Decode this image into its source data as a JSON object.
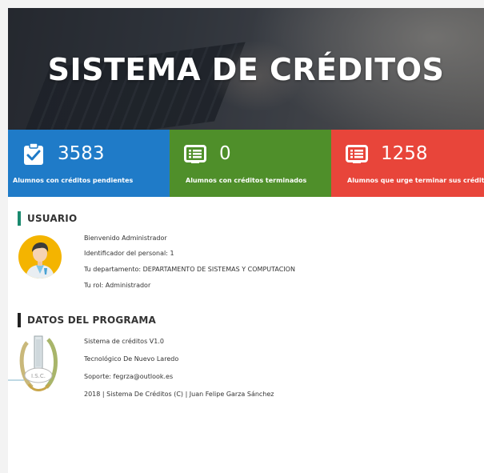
{
  "header": {
    "title": "SISTEMA DE CRÉDITOS"
  },
  "stats": [
    {
      "value": "3583",
      "label": "Alumnos con créditos pendientes",
      "color": "#1f7bc8",
      "icon": "clipboard-check-icon"
    },
    {
      "value": "0",
      "label": "Alumnos con créditos terminados",
      "color": "#4f8f2a",
      "icon": "list-icon"
    },
    {
      "value": "1258",
      "label": "Alumnos que urge terminar sus créditos",
      "color": "#e8453a",
      "icon": "list-icon"
    }
  ],
  "usuario": {
    "title": "USUARIO",
    "accent": "#1b8a6f",
    "lines": [
      "Bienvenido Administrador",
      "Identificador del personal: 1",
      "Tu departamento: DEPARTAMENTO DE SISTEMAS Y COMPUTACION",
      "Tu rol: Administrador"
    ]
  },
  "programa": {
    "title": "DATOS DEL PROGRAMA",
    "accent": "#222222",
    "lines": [
      "Sistema de créditos V1.0",
      "Tecnológico De Nuevo Laredo",
      "Soporte: fegrza@outlook.es",
      "2018 | Sistema De Créditos (C) | Juan Felipe Garza Sánchez"
    ],
    "logo_text": "I.S.C."
  }
}
